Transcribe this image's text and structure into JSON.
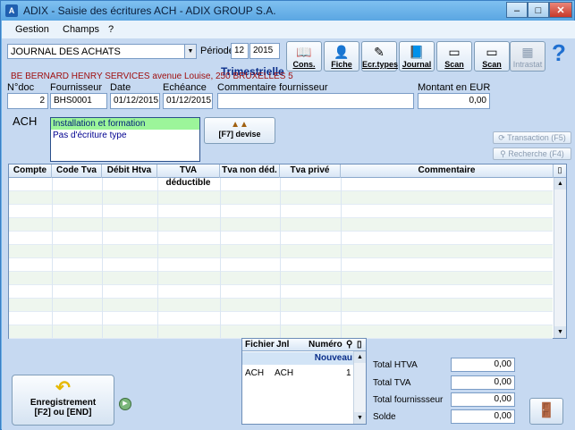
{
  "window": {
    "title": "ADIX - Saisie des écritures  ACH - ADIX GROUP S.A.",
    "app_icon_text": "A"
  },
  "menu": {
    "items": [
      "Gestion",
      "Champs",
      "?"
    ]
  },
  "toolbar": {
    "journal_dropdown": "JOURNAL DES ACHATS",
    "periode_label": "Période",
    "periode_value": "12",
    "annee_value": "2015",
    "periodicity": "Trimestrielle",
    "buttons": [
      {
        "label": "Cons.",
        "icon": "book-icon"
      },
      {
        "label": "Fiche",
        "icon": "person-icon"
      },
      {
        "label": "Ecr.types",
        "icon": "pen-icon"
      },
      {
        "label": "Journal",
        "icon": "journal-icon"
      },
      {
        "label": "Scan",
        "icon": "scanner-icon"
      },
      {
        "label": "Scan",
        "icon": "scanner-icon"
      },
      {
        "label": "Intrastat",
        "icon": "map-icon"
      }
    ]
  },
  "supplier_line": "BE BERNARD HENRY SERVICES avenue Louise, 250 BRUXELLES 5",
  "header_fields": {
    "ndoc_label": "N°doc",
    "ndoc_value": "2",
    "fournisseur_label": "Fournisseur",
    "fournisseur_value": "BHS0001",
    "date_label": "Date",
    "date_value": "01/12/2015",
    "echeance_label": "Echéance",
    "echeance_value": "01/12/2015",
    "commentaire_label": "Commentaire fournisseur",
    "commentaire_value": "",
    "montant_label": "Montant en EUR",
    "montant_value": "0,00"
  },
  "journal_code": "ACH",
  "type_list": [
    "Installation et formation",
    "Pas d'écriture type"
  ],
  "devise_button": "[F7] devise",
  "side_buttons": {
    "transaction": "Transaction (F5)",
    "recherche": "Recherche (F4)"
  },
  "grid": {
    "columns": [
      "Compte",
      "Code Tva",
      "Débit Htva",
      "TVA déductible",
      "Tva non déd.",
      "Tva privé",
      "Commentaire"
    ]
  },
  "files_grid": {
    "columns": [
      "Fichier",
      "Jnl",
      "Numéro"
    ],
    "nouveau": "Nouveau",
    "row": {
      "fichier": "ACH",
      "jnl": "ACH",
      "numero": "1"
    }
  },
  "totals": {
    "htva_label": "Total HTVA",
    "htva_value": "0,00",
    "tva_label": "Total TVA",
    "tva_value": "0,00",
    "fournisseur_label": "Total fournissseur",
    "fournisseur_value": "0,00",
    "solde_label": "Solde",
    "solde_value": "0,00"
  },
  "enregistrement": {
    "label": "Enregistrement",
    "shortcut": "[F2] ou [END]"
  },
  "colors": {
    "selected_row": "#9cf59a",
    "titlebar": "#6ab0e6",
    "background": "#c6d9f1"
  }
}
